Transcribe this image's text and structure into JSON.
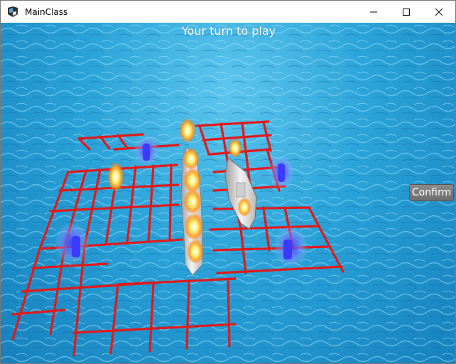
{
  "window": {
    "title": "MainClass"
  },
  "game": {
    "status_text": "Your turn to play",
    "confirm_label": "Confirm",
    "grid_color": "#e11a1a",
    "water_color": "#2aa2d8"
  }
}
